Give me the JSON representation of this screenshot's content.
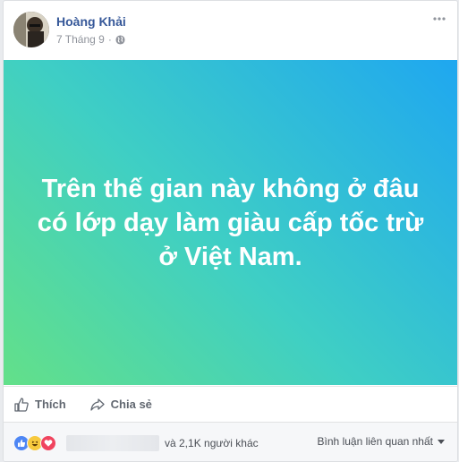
{
  "post": {
    "author": "Hoàng Khải",
    "date": "7 Tháng 9",
    "separator": "·",
    "privacy_icon": "globe-icon",
    "menu_icon": "more-options-icon",
    "banner_text": "Trên thế gian này không ở đâu có lớp dạy làm giàu cấp tốc trừ ở Việt Nam.",
    "banner_colors": [
      "#1fa7f0",
      "#3fcfc4",
      "#63e089"
    ]
  },
  "actions": {
    "like_label": "Thích",
    "share_label": "Chia sẻ"
  },
  "reactions": {
    "icons": [
      "like-icon",
      "haha-icon",
      "love-icon"
    ],
    "others_text": "và 2,1K người khác",
    "sort_label": "Bình luận liên quan nhất"
  }
}
